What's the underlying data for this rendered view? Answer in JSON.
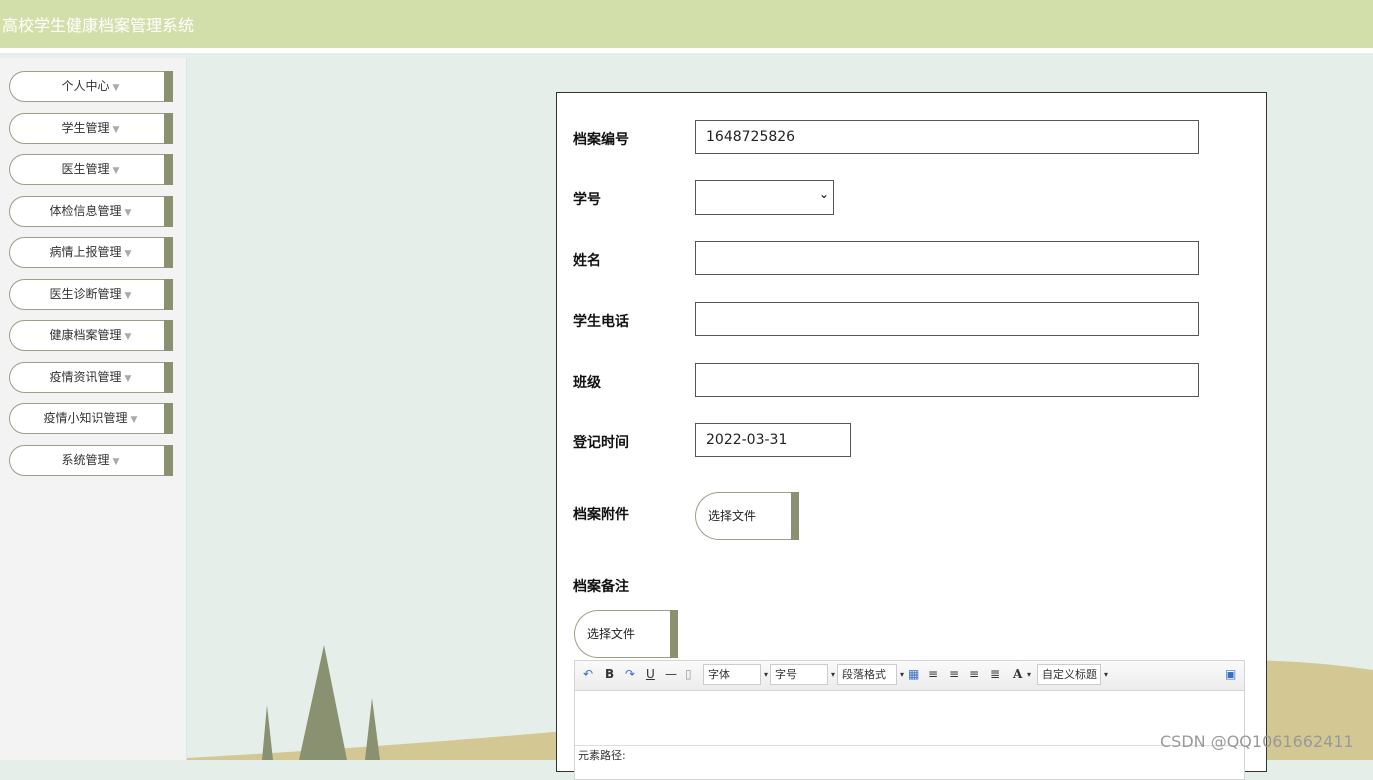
{
  "app": {
    "title": "高校学生健康档案管理系统"
  },
  "sidebar": {
    "items": [
      {
        "label": "个人中心"
      },
      {
        "label": "学生管理"
      },
      {
        "label": "医生管理"
      },
      {
        "label": "体检信息管理"
      },
      {
        "label": "病情上报管理"
      },
      {
        "label": "医生诊断管理"
      },
      {
        "label": "健康档案管理"
      },
      {
        "label": "疫情资讯管理"
      },
      {
        "label": "疫情小知识管理"
      },
      {
        "label": "系统管理"
      }
    ],
    "caret": "▼"
  },
  "form": {
    "archive_no": {
      "label": "档案编号",
      "value": "1648725826"
    },
    "student_no": {
      "label": "学号",
      "value": ""
    },
    "name": {
      "label": "姓名",
      "value": ""
    },
    "phone": {
      "label": "学生电话",
      "value": ""
    },
    "class": {
      "label": "班级",
      "value": ""
    },
    "reg_time": {
      "label": "登记时间",
      "value": "2022-03-31"
    },
    "attachment": {
      "label": "档案附件",
      "button": "选择文件"
    },
    "remark": {
      "label": "档案备注",
      "button": "选择文件"
    }
  },
  "editor": {
    "font_family": "字体",
    "font_size": "字号",
    "paragraph": "段落格式",
    "custom_title": "自定义标题",
    "path_label": "元素路径:"
  },
  "watermark": "CSDN @QQ1061662411",
  "colors": {
    "header_bg": "#d3dfaa",
    "accent": "#8a9170"
  }
}
